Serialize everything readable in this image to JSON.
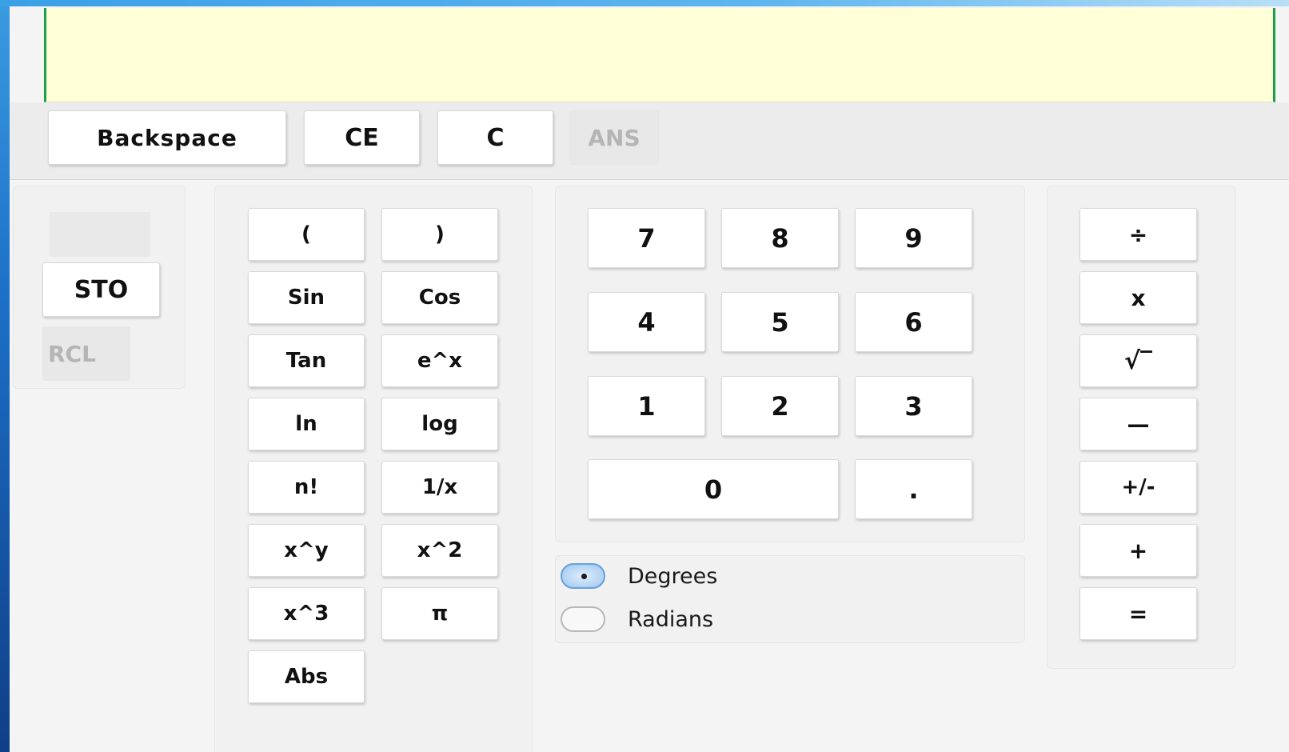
{
  "display": {
    "value": ""
  },
  "top_row": {
    "backspace": "Backspace",
    "ce": "CE",
    "c": "C",
    "ans": "ANS"
  },
  "memory": {
    "sto": "STO",
    "rcl": "RCL"
  },
  "functions": {
    "open_paren": "(",
    "close_paren": ")",
    "sin": "Sin",
    "cos": "Cos",
    "tan": "Tan",
    "exp": "e^x",
    "ln": "ln",
    "log": "log",
    "factorial": "n!",
    "reciprocal": "1/x",
    "power": "x^y",
    "square": "x^2",
    "cube": "x^3",
    "pi": "π",
    "abs": "Abs"
  },
  "digits": {
    "d7": "7",
    "d8": "8",
    "d9": "9",
    "d4": "4",
    "d5": "5",
    "d6": "6",
    "d1": "1",
    "d2": "2",
    "d3": "3",
    "d0": "0",
    "dot": "."
  },
  "angle_mode": {
    "degrees": "Degrees",
    "radians": "Radians",
    "selected": "Degrees"
  },
  "operators": {
    "divide": "÷",
    "multiply": "x",
    "sqrt": "√‾",
    "minus": "—",
    "negate": "+/-",
    "plus": "+",
    "equals": "="
  }
}
